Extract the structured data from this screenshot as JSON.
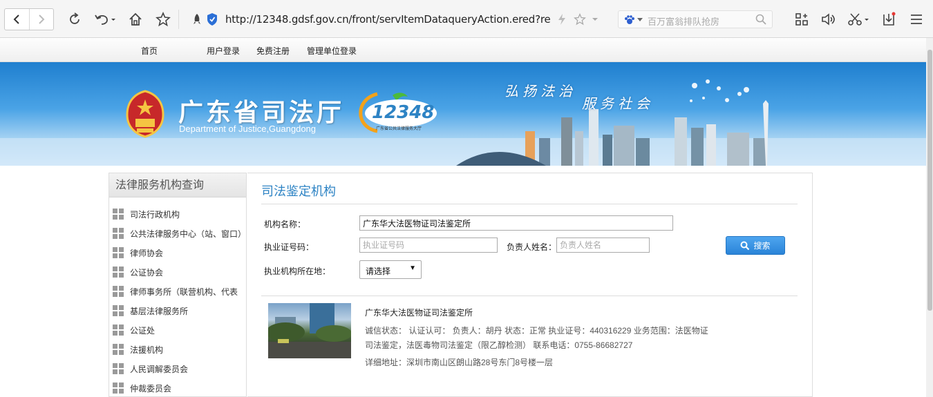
{
  "browser": {
    "url": "http://12348.gdsf.gov.cn/front/servItemDataqueryAction.ered?reqCod",
    "search_placeholder": "百万富翁排队抢房"
  },
  "site_nav": {
    "home": "首页",
    "login": "用户登录",
    "register": "免费注册",
    "admin_login": "管理单位登录"
  },
  "banner": {
    "title": "广东省司法厅",
    "subtitle": "Department of Justice,Guangdong",
    "logo_number": "12348",
    "logo_caption": "广东省公共法律服务大厅",
    "slogan_left": "弘扬法治",
    "slogan_right": "服务社会"
  },
  "sidebar": {
    "heading": "法律服务机构查询",
    "items": [
      {
        "label": "司法行政机构"
      },
      {
        "label": "公共法律服务中心（站、窗口）"
      },
      {
        "label": "律师协会"
      },
      {
        "label": "公证协会"
      },
      {
        "label": "律师事务所（联营机构、代表"
      },
      {
        "label": "基层法律服务所"
      },
      {
        "label": "公证处"
      },
      {
        "label": "法援机构"
      },
      {
        "label": "人民调解委员会"
      },
      {
        "label": "仲裁委员会"
      }
    ]
  },
  "main": {
    "title": "司法鉴定机构",
    "form": {
      "org_name_label": "机构名称：",
      "org_name_value": "广东华大法医物证司法鉴定所",
      "license_label": "执业证号码：",
      "license_placeholder": "执业证号码",
      "principal_label": "负责人姓名：",
      "principal_placeholder": "负责人姓名",
      "location_label": "执业机构所在地：",
      "location_value": "请选择",
      "search_label": "搜索"
    },
    "result": {
      "name": "广东华大法医物证司法鉴定所",
      "line1": "诚信状态：        认证认可：   负责人：胡丹      状态：正常      执业证号：440316229      业务范围：法医物证",
      "line2": "司法鉴定，法医毒物司法鉴定（限乙醇检测）      联系电话：0755-86682727",
      "line3": "详细地址：深圳市南山区朗山路28号东门8号楼一层"
    }
  }
}
